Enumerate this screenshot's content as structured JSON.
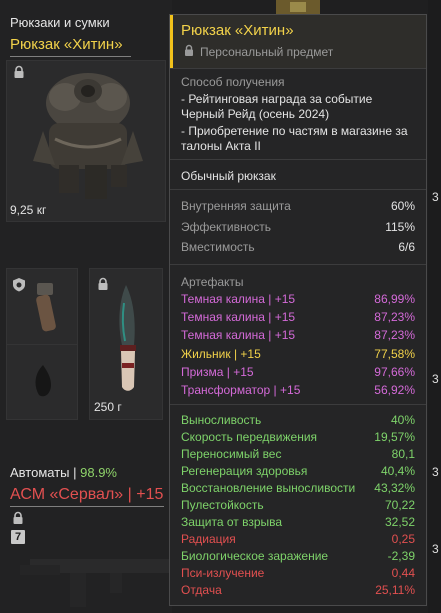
{
  "inventory": {
    "category_label": "Рюкзаки и сумки",
    "item_name": "Рюкзак «Хитин»",
    "item_weight": "9,25 кг",
    "knife_weight": "250 г",
    "weapons_category_label": "Автоматы",
    "weapons_category_sep": " | ",
    "weapons_category_pct": "98.9%",
    "weapon_name": "АСМ «Сервал» | +15",
    "weapon_badge": "7"
  },
  "right_strip": {
    "digits": [
      "3",
      "3",
      "3",
      "3"
    ]
  },
  "tooltip": {
    "title": "Рюкзак «Хитин»",
    "personal_label": "Персональный предмет",
    "acquisition_header": "Способ получения",
    "acquisition_lines": [
      "- Рейтинговая награда за событие",
      "Черный Рейд (осень 2024)",
      "- Приобретение по частям в магазине за",
      "талоны Акта II"
    ],
    "item_type": "Обычный рюкзак",
    "stats": [
      {
        "label": "Внутренняя защита",
        "value": "60%"
      },
      {
        "label": "Эффективность",
        "value": "115%"
      },
      {
        "label": "Вместимость",
        "value": "6/6"
      }
    ],
    "artifacts_header": "Артефакты",
    "artifacts": [
      {
        "name": "Темная калина | +15",
        "value": "86,99%",
        "color": "#d46ad8"
      },
      {
        "name": "Темная калина | +15",
        "value": "87,23%",
        "color": "#d46ad8"
      },
      {
        "name": "Темная калина | +15",
        "value": "87,23%",
        "color": "#d46ad8"
      },
      {
        "name": "Жильник | +15",
        "value": "77,58%",
        "color": "#f2d24a"
      },
      {
        "name": "Призма | +15",
        "value": "97,66%",
        "color": "#d46ad8"
      },
      {
        "name": "Трансформатор | +15",
        "value": "56,92%",
        "color": "#d46ad8"
      }
    ],
    "effects": [
      {
        "name": "Выносливость",
        "value": "40%",
        "color": "#7ed36a"
      },
      {
        "name": "Скорость передвижения",
        "value": "19,57%",
        "color": "#7ed36a"
      },
      {
        "name": "Переносимый вес",
        "value": "80,1",
        "color": "#7ed36a"
      },
      {
        "name": "Регенерация здоровья",
        "value": "40,4%",
        "color": "#7ed36a"
      },
      {
        "name": "Восстановление выносливости",
        "value": "43,32%",
        "color": "#7ed36a"
      },
      {
        "name": "Пулестойкость",
        "value": "70,22",
        "color": "#7ed36a"
      },
      {
        "name": "Защита от взрыва",
        "value": "32,52",
        "color": "#7ed36a"
      },
      {
        "name": "Радиация",
        "value": "0,25",
        "color": "#e25050"
      },
      {
        "name": "Биологическое заражение",
        "value": "-2,39",
        "color": "#7ed36a"
      },
      {
        "name": "Пси-излучение",
        "value": "0,44",
        "color": "#e25050"
      },
      {
        "name": "Отдача",
        "value": "25,11%",
        "color": "#e25050"
      }
    ]
  }
}
